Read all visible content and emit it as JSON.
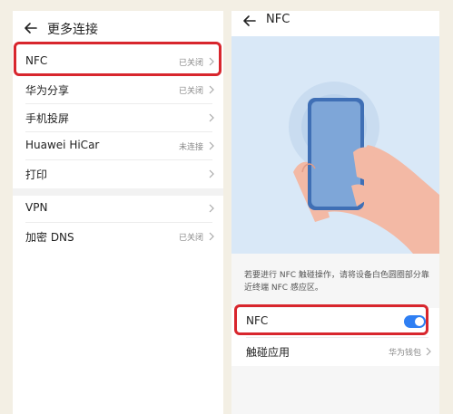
{
  "left": {
    "title": "更多连接",
    "items": [
      {
        "label": "NFC",
        "value": "已关闭"
      },
      {
        "label": "华为分享",
        "value": "已关闭"
      },
      {
        "label": "手机投屏",
        "value": ""
      },
      {
        "label": "Huawei HiCar",
        "value": "未连接"
      },
      {
        "label": "打印",
        "value": ""
      },
      {
        "label": "VPN",
        "value": ""
      },
      {
        "label": "加密 DNS",
        "value": "已关闭"
      }
    ]
  },
  "right": {
    "title": "NFC",
    "description": "若要进行 NFC 触碰操作，请将设备白色圆圈部分靠近终端 NFC 感应区。",
    "nfc_toggle": {
      "label": "NFC",
      "state": "on"
    },
    "touch_app": {
      "label": "触碰应用",
      "value": "华为钱包"
    }
  },
  "colors": {
    "accent": "#2f7ff3",
    "highlight": "#d8262d",
    "illustration_bg": "#d9e8f7"
  }
}
